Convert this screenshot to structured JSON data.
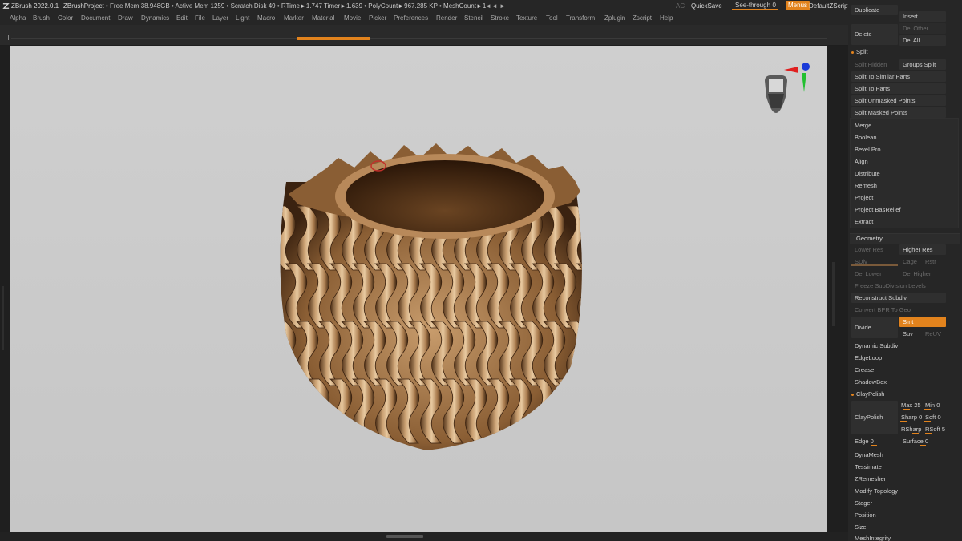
{
  "titlebar": {
    "app": "ZBrush 2022.0.1",
    "project": "ZBrushProject",
    "stats": "• Free Mem 38.948GB • Active Mem 1259 • Scratch Disk 49 • RTime►1.747 Timer►1.639 • PolyCount►967.285 KP • MeshCount►1",
    "arrows": "◄◄ ►",
    "ac": "AC",
    "quicksave": "QuickSave",
    "seethrough_label": "See-through",
    "seethrough_value": "0",
    "menus": "Menus",
    "default_zscript": "DefaultZScript"
  },
  "menubar": [
    "Alpha",
    "Brush",
    "Color",
    "Document",
    "Draw",
    "Dynamics",
    "Edit",
    "File",
    "Layer",
    "Light",
    "Macro",
    "Marker",
    "Material",
    "Movie",
    "Picker",
    "Preferences",
    "Render",
    "Stencil",
    "Stroke",
    "Texture",
    "Tool",
    "Transform",
    "Zplugin",
    "Zscript",
    "Help"
  ],
  "panel": {
    "top": {
      "duplicate": "Duplicate",
      "insert": "Insert",
      "delete": "Delete",
      "del_other": "Del Other",
      "del_all": "Del All"
    },
    "split": {
      "title": "Split",
      "split_hidden": "Split Hidden",
      "groups_split": "Groups Split",
      "items": [
        "Split To Similar Parts",
        "Split To Parts",
        "Split Unmasked Points",
        "Split Masked Points"
      ]
    },
    "subtool_tools": [
      "Merge",
      "Boolean",
      "Bevel Pro",
      "Align",
      "Distribute",
      "Remesh",
      "Project",
      "Project BasRelief",
      "Extract"
    ],
    "geometry": {
      "title": "Geometry",
      "lower_res": "Lower Res",
      "higher_res": "Higher Res",
      "sdiv": "SDiv",
      "cage": "Cage",
      "rstr": "Rstr",
      "del_lower": "Del Lower",
      "del_higher": "Del Higher",
      "freeze": "Freeze SubDivision Levels",
      "reconstruct": "Reconstruct Subdiv",
      "convert_bpr": "Convert BPR To Geo",
      "divide": "Divide",
      "smt": "Smt",
      "suv": "Suv",
      "reuv": "ReUV",
      "items": [
        "Dynamic Subdiv",
        "EdgeLoop",
        "Crease",
        "ShadowBox"
      ]
    },
    "claypolish": {
      "title": "ClayPolish",
      "button": "ClayPolish",
      "max_label": "Max",
      "max_value": "25",
      "min_label": "Min",
      "min_value": "0",
      "sharp_label": "Sharp",
      "sharp_value": "0",
      "soft_label": "Soft",
      "soft_value": "0",
      "rsharp_label": "RSharp",
      "rsharp_value": "",
      "rsoft_label": "RSoft",
      "rsoft_value": "5",
      "edge_label": "Edge",
      "edge_value": "0",
      "surface_label": "Surface",
      "surface_value": "0"
    },
    "bottom_items": [
      "DynaMesh",
      "Tessimate",
      "ZRemesher",
      "Modify Topology",
      "Stager",
      "Position",
      "Size",
      "MeshIntegrity"
    ]
  },
  "colors": {
    "accent": "#e2831d",
    "canvas_bg": "#cccccc",
    "panel_bg": "#262626",
    "model_bronze": "#b88a5a"
  }
}
